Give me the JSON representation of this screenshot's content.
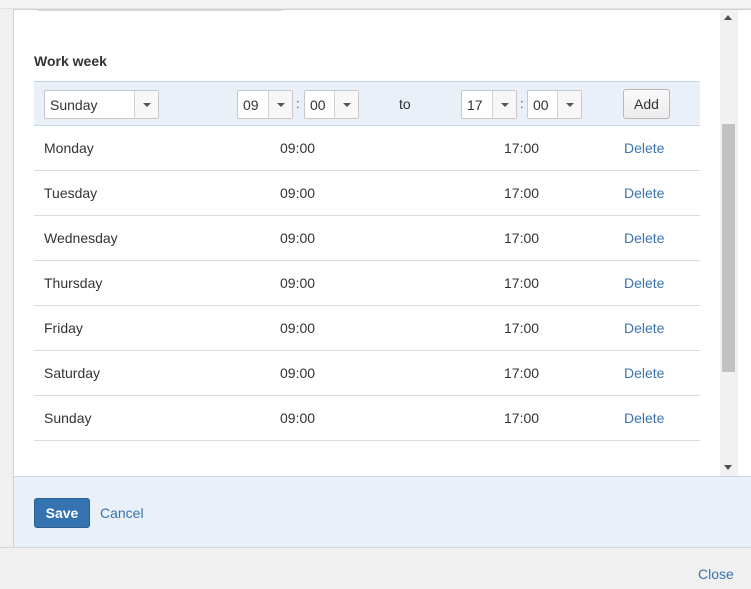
{
  "section_title": "Work week",
  "add_row": {
    "day_select": "Sunday",
    "from_hour": "09",
    "from_minute": "00",
    "separator": ":",
    "to_label": "to",
    "to_hour": "17",
    "to_minute": "00",
    "add_label": "Add"
  },
  "rows": [
    {
      "day": "Monday",
      "start": "09:00",
      "end": "17:00",
      "action": "Delete"
    },
    {
      "day": "Tuesday",
      "start": "09:00",
      "end": "17:00",
      "action": "Delete"
    },
    {
      "day": "Wednesday",
      "start": "09:00",
      "end": "17:00",
      "action": "Delete"
    },
    {
      "day": "Thursday",
      "start": "09:00",
      "end": "17:00",
      "action": "Delete"
    },
    {
      "day": "Friday",
      "start": "09:00",
      "end": "17:00",
      "action": "Delete"
    },
    {
      "day": "Saturday",
      "start": "09:00",
      "end": "17:00",
      "action": "Delete"
    },
    {
      "day": "Sunday",
      "start": "09:00",
      "end": "17:00",
      "action": "Delete"
    }
  ],
  "footer": {
    "save_label": "Save",
    "cancel_label": "Cancel"
  },
  "close_label": "Close",
  "colors": {
    "accent": "#3572b0",
    "link": "#3b73af",
    "panel": "#e9f0f8"
  },
  "icons": {
    "dropdown": "chevron-down-icon",
    "scroll_up": "scroll-up-icon",
    "scroll_down": "scroll-down-icon"
  }
}
